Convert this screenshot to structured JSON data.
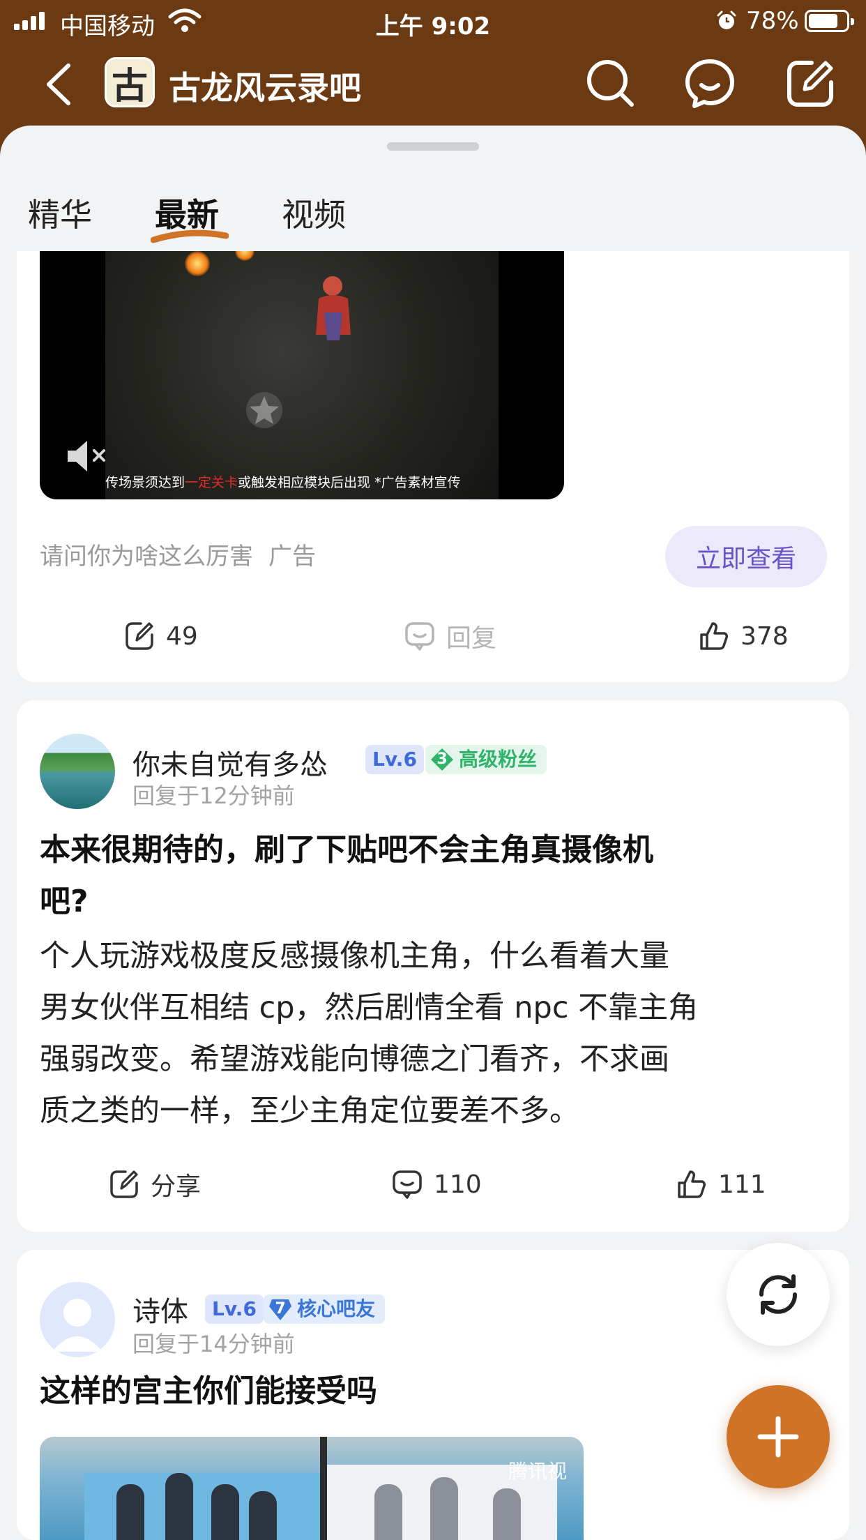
{
  "status_bar": {
    "carrier": "中国移动",
    "time": "上午 9:02",
    "battery": "78%",
    "battery_level": 0.78
  },
  "nav": {
    "forum_logo_glyph": "古",
    "forum_title": "古龙风云录吧"
  },
  "tabs": [
    {
      "label": "精华",
      "active": false
    },
    {
      "label": "最新",
      "active": true
    },
    {
      "label": "视频",
      "active": false
    }
  ],
  "ad_post": {
    "caption_prefix": "传场景须达到",
    "caption_highlight": "一定关卡",
    "caption_suffix": "或触发相应模块后出现  *广告素材宣传",
    "text": "请问你为啥这么厉害",
    "tag": "广告",
    "cta_label": "立即查看",
    "share_count": "49",
    "reply_label": "回复",
    "like_count": "378"
  },
  "posts": [
    {
      "username": "你未自觉有多怂",
      "level": "Lv.6",
      "fan_level": "3",
      "fan_title": "高级粉丝",
      "reply_time": "回复于12分钟前",
      "title_line1": "本来很期待的，刷了下贴吧不会主角真摄像机",
      "title_line2": "吧?",
      "body_lines": [
        "个人玩游戏极度反感摄像机主角，什么看着大量",
        "男女伙伴互相结 cp，然后剧情全看 npc 不靠主角",
        "强弱改变。希望游戏能向博德之门看齐，不求画",
        "质之类的一样，至少主角定位要差不多。"
      ],
      "share_label": "分享",
      "comment_count": "110",
      "like_count": "111"
    },
    {
      "username": "诗体",
      "level": "Lv.6",
      "fan_level": "7",
      "fan_title": "核心吧友",
      "reply_time": "回复于14分钟前",
      "title": "这样的宫主你们能接受吗",
      "image_watermark": "腾讯视"
    }
  ],
  "colors": {
    "header_brown": "#6b3a12",
    "accent_orange": "#cf7327",
    "cta_purple": "#6a52c9",
    "fan_green": "#31b36b",
    "fan_blue": "#3a76d8"
  },
  "icons": [
    "back-icon",
    "search-icon",
    "message-icon",
    "edit-icon",
    "share-icon",
    "comment-icon",
    "like-icon",
    "mute-icon",
    "refresh-icon",
    "plus-icon"
  ]
}
